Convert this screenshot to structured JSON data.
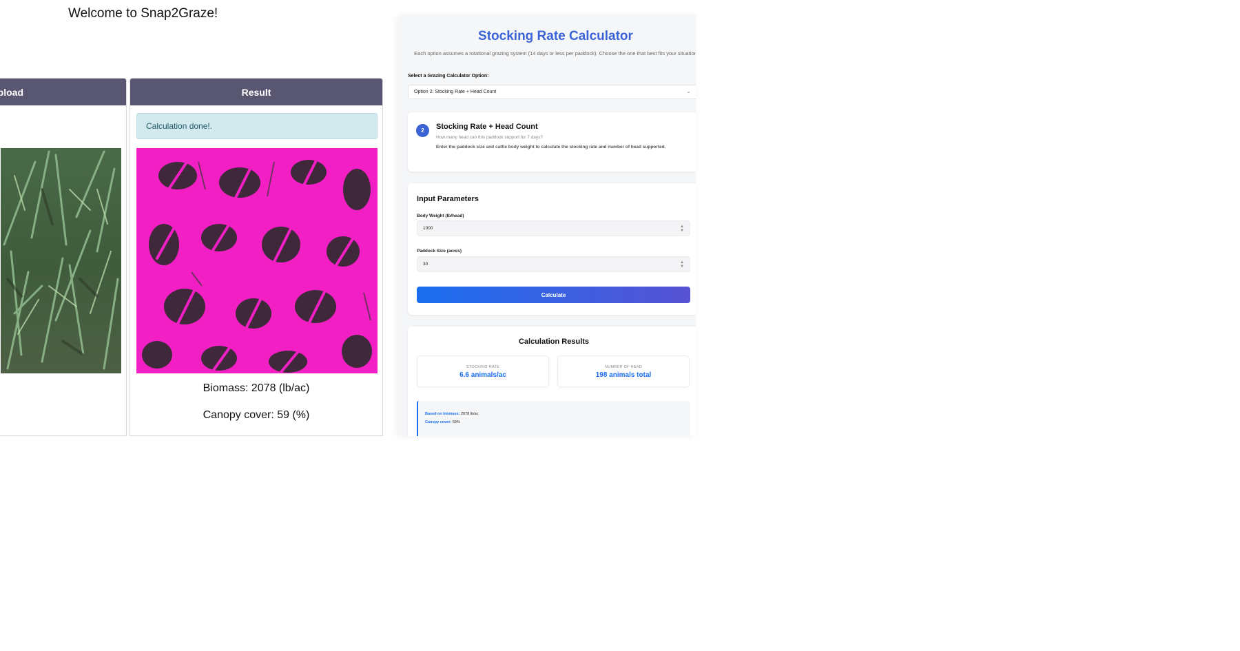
{
  "app": {
    "welcome": "Welcome to Snap2Graze!"
  },
  "upload_panel": {
    "header": "upload"
  },
  "result_panel": {
    "header": "Result",
    "alert": "Calculation done!.",
    "biomass": "Biomass: 2078 (lb/ac)",
    "canopy": "Canopy cover: 59 (%)"
  },
  "calculator": {
    "title": "Stocking Rate Calculator",
    "subtitle": "Each option assumes a rotational grazing system (14 days or less per paddock). Choose the one that best fits your situation",
    "option_label": "Select a Grazing Calculator Option:",
    "option_selected": "Option 2: Stocking Rate + Head Count",
    "option_card": {
      "number": "2",
      "title": "Stocking Rate + Head Count",
      "question": "How many head can this paddock support for 7 days?",
      "description": "Enter the paddock size and cattle body weight to calculate the stocking rate and number of head supported."
    },
    "params": {
      "title": "Input Parameters",
      "body_weight_label": "Body Weight (lb/head)",
      "body_weight_value": "1000",
      "paddock_label": "Paddock Size (acres)",
      "paddock_value": "30",
      "calculate_label": "Calculate"
    },
    "results": {
      "title": "Calculation Results",
      "stocking_rate_label": "STOCKING RATE",
      "stocking_rate_value": "6.6 animals/ac",
      "head_label": "NUMBER OF HEAD",
      "head_value": "198 animals total",
      "biomass_key": "Based on biomass:",
      "biomass_value": " 2078 lb/ac",
      "canopy_key": "Canopy cover:",
      "canopy_value": " 59%"
    }
  },
  "colors": {
    "header_bg": "#585670",
    "accent": "#3b63d6",
    "button_start": "#1a6ff0",
    "button_end": "#5752d4",
    "mask": "#f21fc5"
  }
}
